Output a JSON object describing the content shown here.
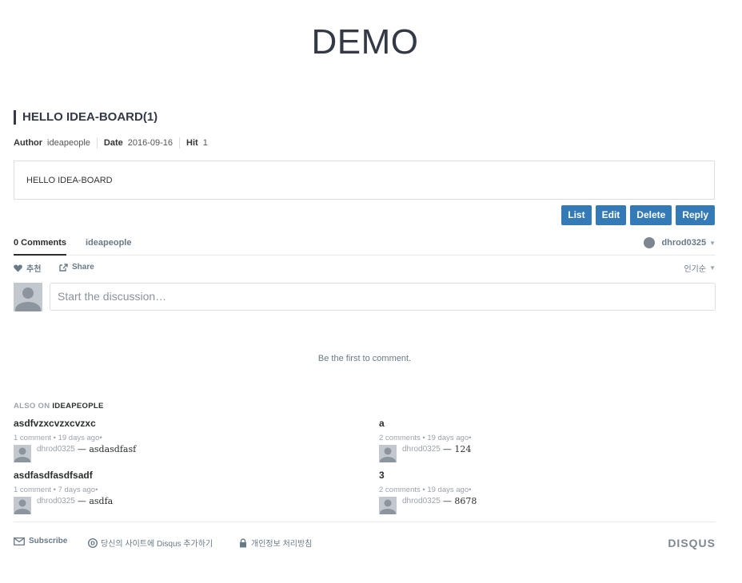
{
  "site": {
    "title": "DEMO"
  },
  "post": {
    "title": "HELLO IDEA-BOARD(1)",
    "meta": {
      "author_label": "Author",
      "author": "ideapeople",
      "date_label": "Date",
      "date": "2016-09-16",
      "hit_label": "Hit",
      "hit": "1"
    },
    "content": "HELLO IDEA-BOARD"
  },
  "buttons": {
    "list": "List",
    "edit": "Edit",
    "delete": "Delete",
    "reply": "Reply"
  },
  "disqus": {
    "tab_comments": "0 Comments",
    "tab_community": "ideapeople",
    "user": "dhrod0325",
    "recommend": "추천",
    "share": "Share",
    "sort": "인기순",
    "placeholder": "Start the discussion…",
    "empty": "Be the first to comment.",
    "also_prefix": "ALSO ON",
    "also_site": "IDEAPEOPLE",
    "related": [
      {
        "title": "asdfvzxcvzxcvzxc",
        "meta": "1 comment • 19 days ago•",
        "user": "dhrod0325",
        "excerpt": "— asdasdfasf"
      },
      {
        "title": "a",
        "meta": "2 comments • 19 days ago•",
        "user": "dhrod0325",
        "excerpt": "— 124"
      },
      {
        "title": "asdfasdfasdfsadf",
        "meta": "1 comment • 7 days ago•",
        "user": "dhrod0325",
        "excerpt": "— asdfa"
      },
      {
        "title": "3",
        "meta": "2 comments • 19 days ago•",
        "user": "dhrod0325",
        "excerpt": "— 8678"
      }
    ],
    "footer": {
      "subscribe": "Subscribe",
      "add_disqus": "당신의 사이트에 Disqus 추가하기",
      "privacy": "개인정보 처리방침",
      "brand": "DISQUS"
    }
  },
  "colors": {
    "primary_button": "#337ab7",
    "heading": "#333a45",
    "muted": "#687a86"
  }
}
